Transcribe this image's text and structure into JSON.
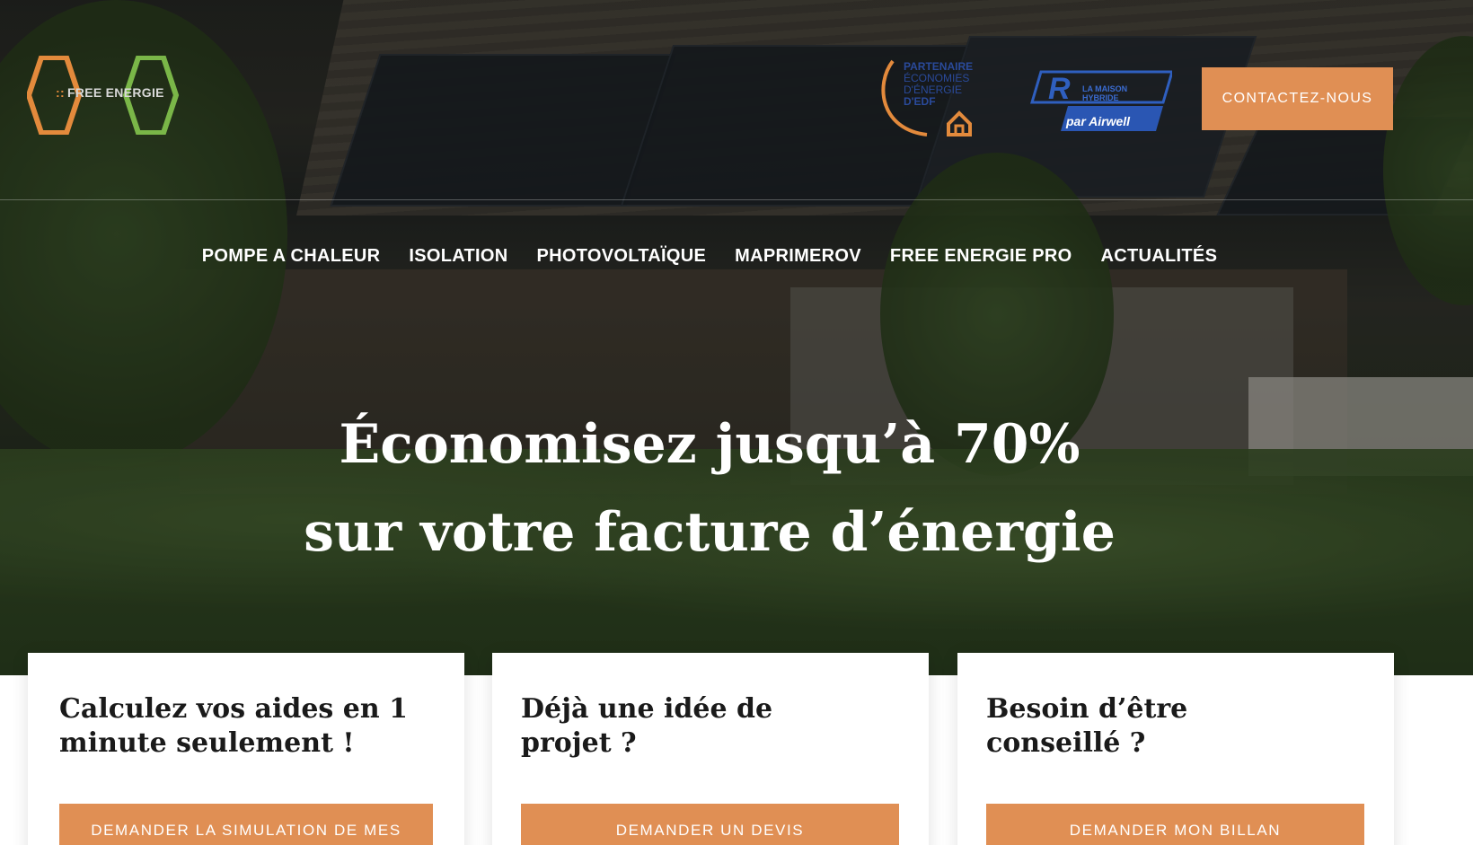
{
  "brand": {
    "logo_text": "FREE ENERGIE",
    "logo_dots": "::",
    "accent_orange": "#e08f54",
    "accent_green": "#7ab648",
    "logo_orange": "#e38a3c"
  },
  "partners": {
    "edf": {
      "lines": [
        "PARTENAIRE",
        "ÉCONOMIES",
        "D'ÉNERGIE",
        "D'EDF"
      ]
    },
    "airwell": {
      "sub_lines": [
        "LA MAISON",
        "HYBRIDE"
      ],
      "label": "par Airwell"
    }
  },
  "header": {
    "contact_label": "CONTACTEZ-NOUS"
  },
  "nav": {
    "items": [
      {
        "label": "POMPE A CHALEUR"
      },
      {
        "label": "ISOLATION"
      },
      {
        "label": "PHOTOVOLTAÏQUE"
      },
      {
        "label": "MAPRIMEROV"
      },
      {
        "label": "FREE ENERGIE PRO"
      },
      {
        "label": "ACTUALITÉS"
      }
    ]
  },
  "hero": {
    "title_line1": "Économisez jusqu’à 70%",
    "title_line2": "sur votre facture d’énergie"
  },
  "cards": [
    {
      "title": "Calculez vos aides en 1 minute seulement !",
      "button": "DEMANDER LA SIMULATION DE MES"
    },
    {
      "title": "Déjà une idée de projet ?",
      "button": "DEMANDER UN DEVIS"
    },
    {
      "title": "Besoin d’être conseillé ?",
      "button": "DEMANDER MON BILLAN"
    }
  ]
}
